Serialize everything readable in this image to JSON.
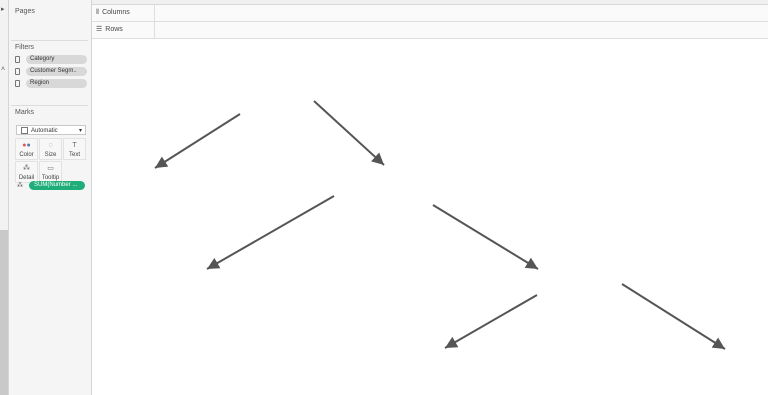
{
  "panes": {
    "pages_title": "Pages",
    "filters_title": "Filters",
    "marks_title": "Marks"
  },
  "filters": [
    "Category",
    "Customer Segm..",
    "Region"
  ],
  "marks": {
    "type_selected": "Automatic",
    "buttons": [
      {
        "label": "Color",
        "icon": "color-dots-icon"
      },
      {
        "label": "Size",
        "icon": "size-icon"
      },
      {
        "label": "Text",
        "icon": "text-icon"
      },
      {
        "label": "Detail",
        "icon": "detail-icon"
      },
      {
        "label": "Tooltip",
        "icon": "tooltip-icon"
      }
    ],
    "field_pill": "SUM(Number ..."
  },
  "shelves": {
    "columns": "Columns",
    "rows": "Rows"
  },
  "colors": {
    "pill_green": "#1fad7a",
    "pill_gray": "#d8d8d8",
    "arrow": "#555555"
  }
}
